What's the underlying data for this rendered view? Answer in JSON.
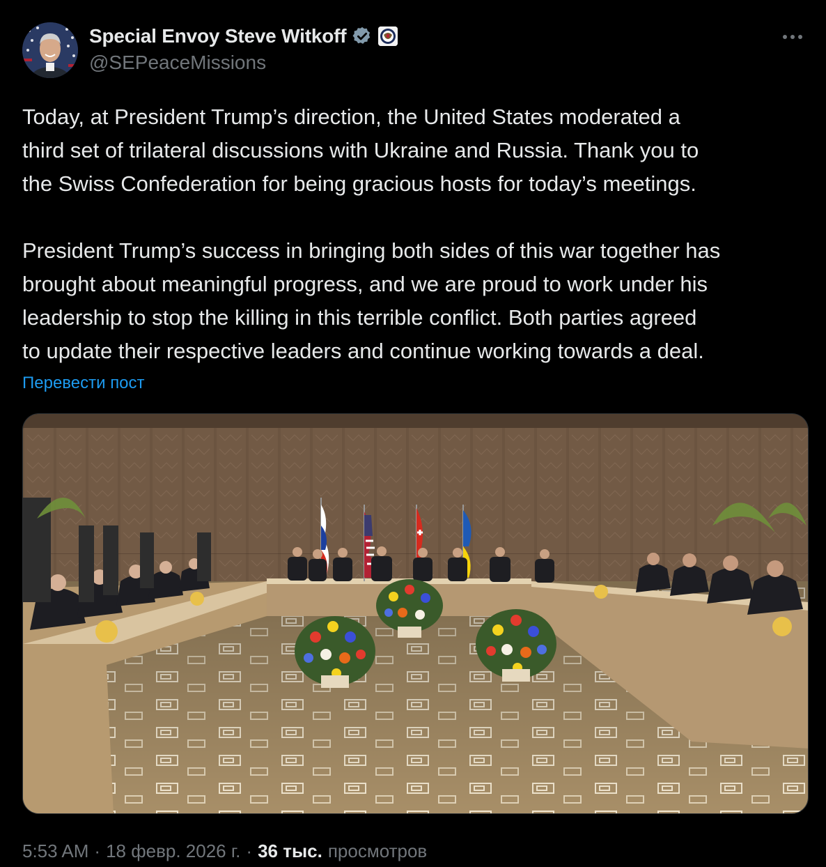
{
  "author": {
    "display_name": "Special Envoy Steve Witkoff",
    "handle": "@SEPeaceMissions",
    "verified_color": "#829aab",
    "affiliate_badge_icon": "us-department-of-state-seal-icon",
    "avatar_icon": "profile-photo-avatar"
  },
  "more_menu_icon": "more-horizontal-icon",
  "tweet": {
    "paragraph_1": "Today, at President Trump’s direction, the United States moderated a\nthird set of trilateral discussions with Ukraine and Russia. Thank you to\nthe Swiss Confederation for being gracious hosts for today’s meetings.",
    "paragraph_2": "President Trump’s success in bringing both sides of this war together has\nbrought about meaningful progress, and we are proud to work under his\nleadership to stop the killing in this terrible conflict. Both parties agreed\nto update their respective leaders and continue working towards a deal."
  },
  "translate_label": "Перевести пост",
  "media": {
    "type": "photo",
    "subject": "conference-room-meeting-photo"
  },
  "meta": {
    "time": "5:53 AM",
    "separator": "·",
    "date": "18 февр. 2026 г.",
    "views_count": "36 тыс.",
    "views_label": "просмотров"
  },
  "colors": {
    "background": "#000000",
    "text_primary": "#e7e9ea",
    "text_secondary": "#71767b",
    "link": "#1d9bf0"
  }
}
